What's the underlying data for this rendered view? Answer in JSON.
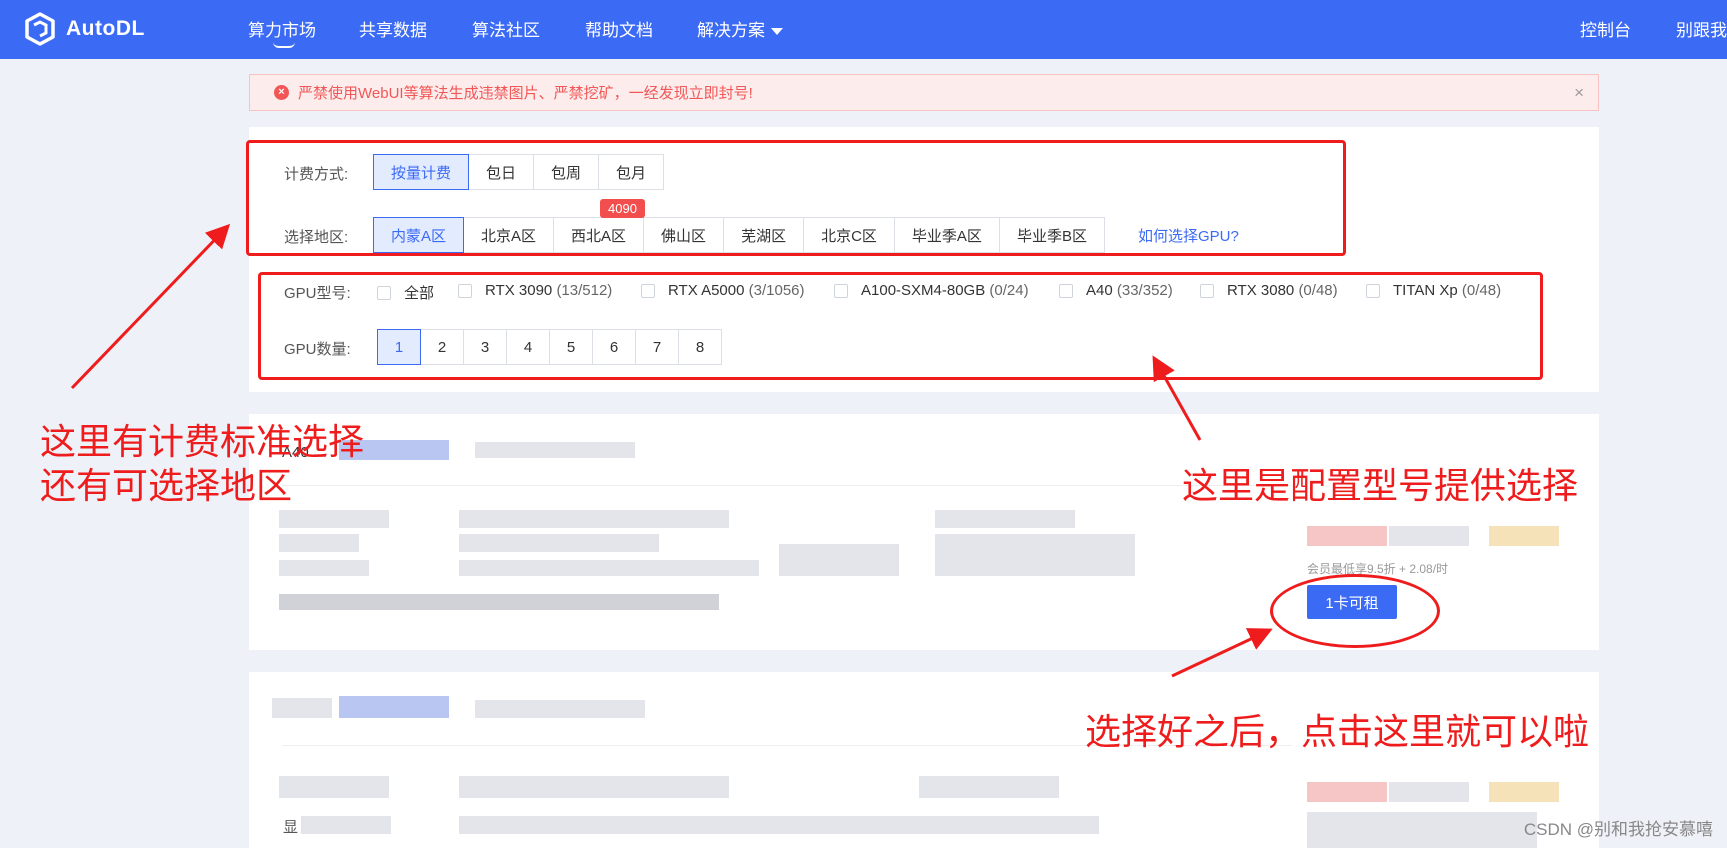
{
  "nav": {
    "brand": "AutoDL",
    "items": [
      "算力市场",
      "共享数据",
      "算法社区",
      "帮助文档",
      "解决方案"
    ],
    "right_items": [
      "控制台",
      "别跟我"
    ]
  },
  "alert": {
    "text": "严禁使用WebUI等算法生成违禁图片、严禁挖矿，一经发现立即封号!",
    "icon": "×",
    "close": "×"
  },
  "filters": {
    "billing_label": "计费方式:",
    "billing_options": [
      "按量计费",
      "包日",
      "包周",
      "包月"
    ],
    "region_label": "选择地区:",
    "regions": [
      "内蒙A区",
      "北京A区",
      "西北A区",
      "佛山区",
      "芜湖区",
      "北京C区",
      "毕业季A区",
      "毕业季B区"
    ],
    "region_badge": "4090",
    "how_to_link": "如何选择GPU?",
    "gpu_type_label": "GPU型号:",
    "gpu_types": [
      {
        "name": "全部",
        "count": ""
      },
      {
        "name": "RTX 3090",
        "count": "(13/512)"
      },
      {
        "name": "RTX A5000",
        "count": "(3/1056)"
      },
      {
        "name": "A100-SXM4-80GB",
        "count": "(0/24)"
      },
      {
        "name": "A40",
        "count": "(33/352)"
      },
      {
        "name": "RTX 3080",
        "count": "(0/48)"
      },
      {
        "name": "TITAN Xp",
        "count": "(0/48)"
      }
    ],
    "gpu_count_label": "GPU数量:",
    "gpu_counts": [
      "1",
      "2",
      "3",
      "4",
      "5",
      "6",
      "7",
      "8"
    ]
  },
  "card1": {
    "title": "A40",
    "member_text": "会员最低享9.5折 + 2.08/时",
    "rent_button": "1卡可租"
  },
  "card2": {
    "fragment": "显"
  },
  "annotations": {
    "left": [
      "这里有计费标准选择",
      "还有可选择地区"
    ],
    "right": "这里是配置型号提供选择",
    "bottom": "选择好之后，点击这里就可以啦"
  },
  "watermark": "CSDN @别和我抢安慕嘻",
  "colors": {
    "brand": "#3b6af5",
    "annotation": "#ee1c1c",
    "alert": "#f25656"
  }
}
